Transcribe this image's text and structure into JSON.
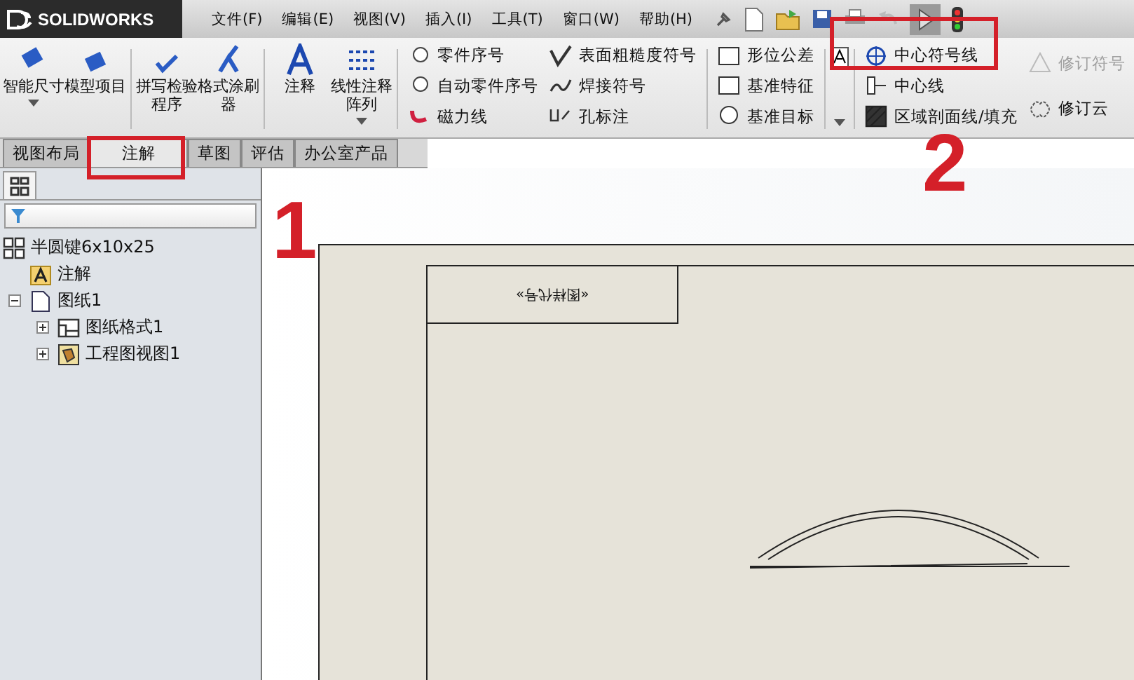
{
  "logo": {
    "text": "SOLIDWORKS"
  },
  "menu": [
    "文件(F)",
    "编辑(E)",
    "视图(V)",
    "插入(I)",
    "工具(T)",
    "窗口(W)",
    "帮助(H)"
  ],
  "ribbon": {
    "big_buttons": [
      {
        "label": "智能尺寸",
        "dropdown": true
      },
      {
        "label": "模型项目",
        "dropdown": false
      },
      {
        "label": "拼写检验程序",
        "dropdown": false
      },
      {
        "label": "格式涂刷器",
        "dropdown": false
      },
      {
        "label": "注释",
        "dropdown": false
      },
      {
        "label": "线性注释阵列",
        "dropdown": true
      }
    ],
    "small_columns": [
      [
        {
          "label": "零件序号",
          "disabled": false
        },
        {
          "label": "自动零件序号",
          "disabled": false
        },
        {
          "label": "磁力线",
          "disabled": false
        }
      ],
      [
        {
          "label": "表面粗糙度符号",
          "disabled": false
        },
        {
          "label": "焊接符号",
          "disabled": false
        },
        {
          "label": "孔标注",
          "disabled": false
        }
      ],
      [
        {
          "label": "形位公差",
          "disabled": false
        },
        {
          "label": "基准特征",
          "disabled": false
        },
        {
          "label": "基准目标",
          "disabled": false
        }
      ],
      [
        {
          "label": "中心符号线",
          "disabled": false
        },
        {
          "label": "中心线",
          "disabled": false
        },
        {
          "label": "区域剖面线/填充",
          "disabled": false
        }
      ],
      [
        {
          "label": "修订符号",
          "disabled": true
        },
        {
          "label": "修订云",
          "disabled": false
        }
      ]
    ]
  },
  "tabs": [
    {
      "label": "视图布局",
      "selected": false
    },
    {
      "label": "注解",
      "selected": true
    },
    {
      "label": "草图",
      "selected": false
    },
    {
      "label": "评估",
      "selected": false
    },
    {
      "label": "办公室产品",
      "selected": false
    }
  ],
  "tree": {
    "label": "半圆键6x10x25",
    "children": [
      {
        "label": "注解",
        "kind": "annotation"
      },
      {
        "label": "图纸1",
        "kind": "sheet",
        "expanded": true,
        "children": [
          {
            "label": "图纸格式1",
            "kind": "format",
            "expanded": false
          },
          {
            "label": "工程图视图1",
            "kind": "view",
            "expanded": false
          }
        ]
      }
    ]
  },
  "sheet": {
    "title_cell": "«图样代号»"
  },
  "annotations": [
    {
      "label": "1"
    },
    {
      "label": "2"
    }
  ]
}
